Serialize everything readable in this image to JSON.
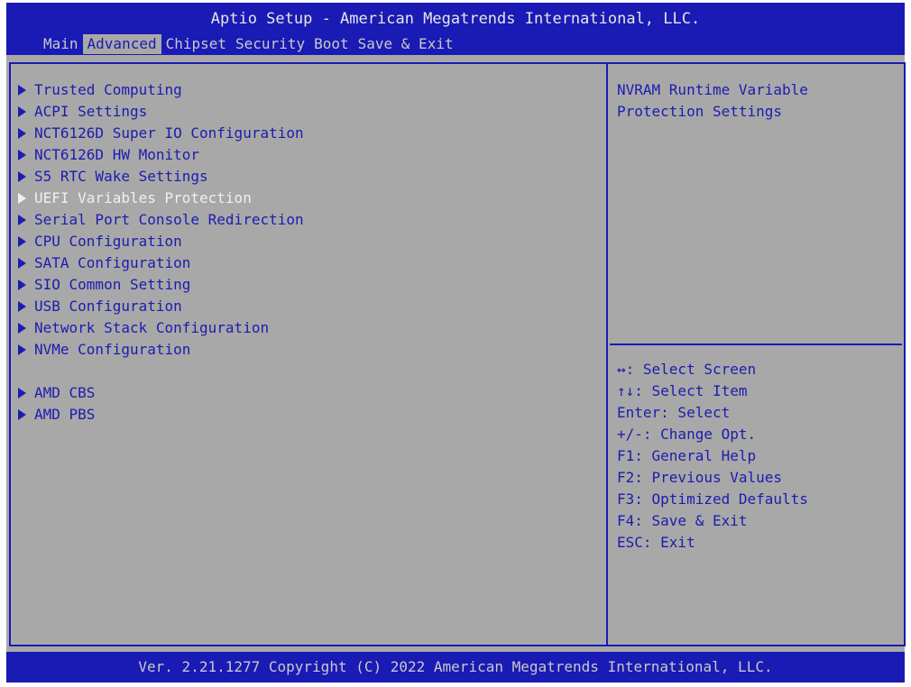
{
  "header": {
    "title": "Aptio Setup - American Megatrends International, LLC.",
    "tabs": [
      "Main",
      "Advanced",
      "Chipset",
      "Security",
      "Boot",
      "Save & Exit"
    ],
    "active_tab": "Advanced"
  },
  "menu": {
    "items": [
      "Trusted Computing",
      "ACPI Settings",
      "NCT6126D Super IO Configuration",
      "NCT6126D HW Monitor",
      "S5 RTC Wake Settings",
      "UEFI Variables Protection",
      "Serial Port Console Redirection",
      "CPU Configuration",
      "SATA Configuration",
      "SIO Common Setting",
      "USB Configuration",
      "Network Stack Configuration",
      "NVMe Configuration",
      "AMD CBS",
      "AMD PBS"
    ],
    "selected": "UEFI Variables Protection"
  },
  "help": {
    "description": "NVRAM Runtime Variable\nProtection Settings",
    "keys": [
      "↔: Select Screen",
      "↑↓: Select Item",
      "Enter: Select",
      "+/-: Change Opt.",
      "F1: General Help",
      "F2: Previous Values",
      "F3: Optimized Defaults",
      "F4: Save & Exit",
      "ESC: Exit"
    ]
  },
  "footer": {
    "text": "Ver. 2.21.1277 Copyright (C) 2022 American Megatrends International, LLC."
  },
  "colors": {
    "background": "#a8a8a8",
    "accent_blue": "#1a1ab4",
    "selected_text": "#f0f0f0"
  }
}
